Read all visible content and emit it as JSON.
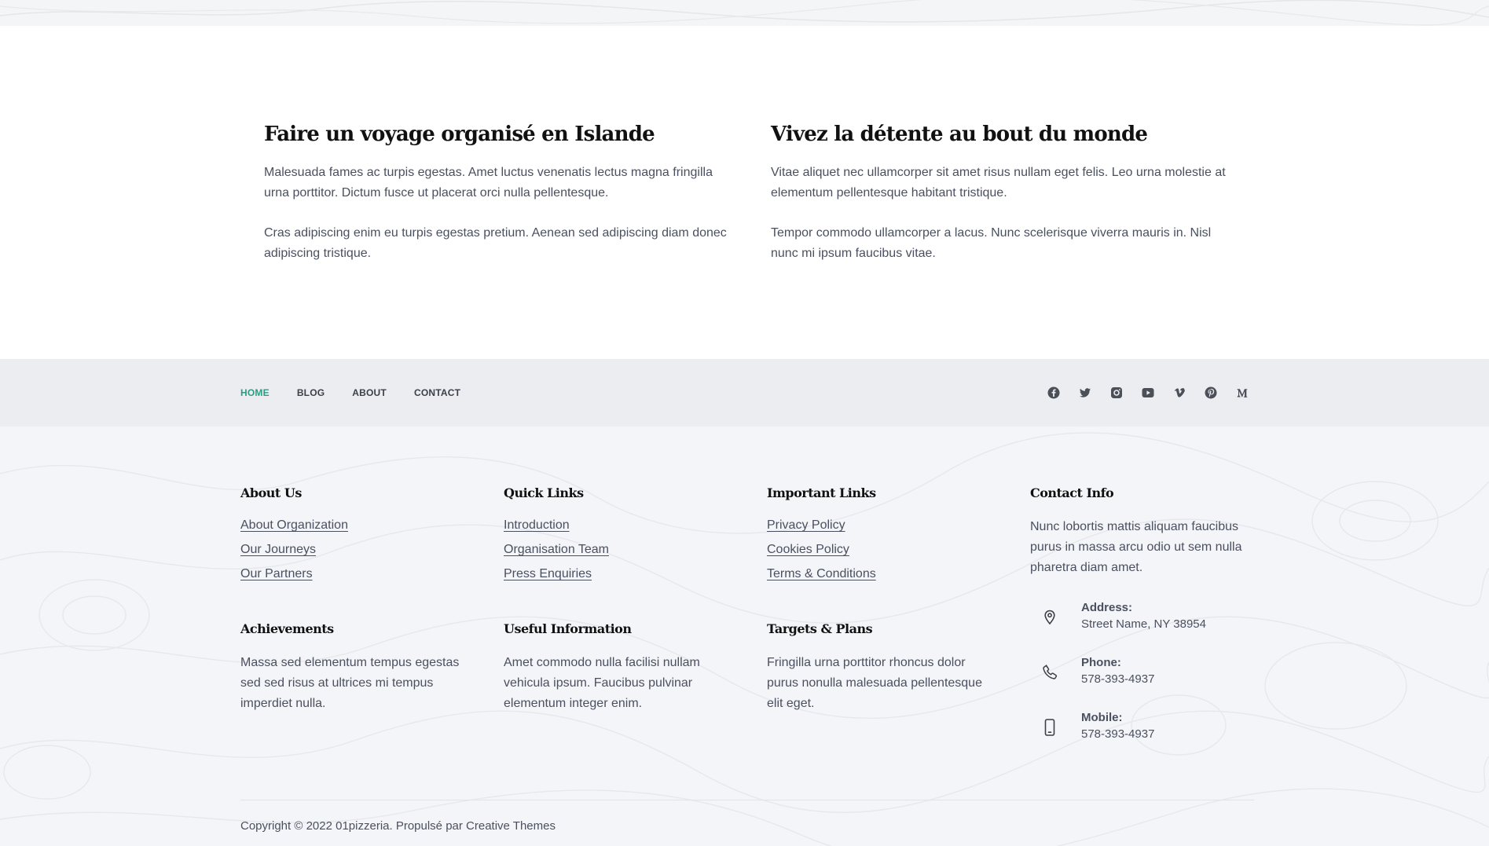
{
  "content": {
    "left": {
      "title": "Faire un voyage organisé en Islande",
      "p1": "Malesuada fames ac turpis egestas. Amet luctus venenatis lectus magna fringilla urna porttitor. Dictum fusce ut placerat orci nulla pellentesque.",
      "p2": "Cras adipiscing enim eu turpis egestas pretium. Aenean sed adipiscing diam donec adipiscing tristique."
    },
    "right": {
      "title": "Vivez la détente au bout du monde",
      "p1": "Vitae aliquet nec ullamcorper sit amet risus nullam eget felis. Leo urna molestie at elementum  pellentesque habitant tristique.",
      "p2": "Tempor commodo ullamcorper a lacus. Nunc scelerisque viverra mauris in. Nisl nunc mi ipsum faucibus vitae."
    }
  },
  "nav": {
    "items": [
      "HOME",
      "BLOG",
      "ABOUT",
      "CONTACT"
    ],
    "active": "HOME",
    "active_color": "#2b9b82"
  },
  "socials": [
    "facebook-icon",
    "twitter-icon",
    "instagram-icon",
    "youtube-icon",
    "vimeo-icon",
    "pinterest-icon",
    "medium-icon"
  ],
  "footer": {
    "about": {
      "title": "About Us",
      "links": [
        "About Organization",
        "Our Journeys",
        "Our Partners"
      ]
    },
    "quick": {
      "title": "Quick Links",
      "links": [
        "Introduction",
        "Organisation Team",
        "Press Enquiries"
      ]
    },
    "important": {
      "title": "Important Links",
      "links": [
        "Privacy Policy",
        "Cookies Policy",
        "Terms & Conditions"
      ]
    },
    "achievements": {
      "title": "Achievements",
      "text": "Massa sed elementum tempus egestas sed sed risus at ultrices mi tempus imperdiet nulla."
    },
    "useful": {
      "title": "Useful Information",
      "text": "Amet commodo nulla facilisi nullam vehicula ipsum. Faucibus pulvinar elementum integer enim."
    },
    "targets": {
      "title": "Targets & Plans",
      "text": "Fringilla urna porttitor rhoncus dolor purus nonulla malesuada pellentesque elit eget."
    },
    "contact": {
      "title": "Contact Info",
      "text": "Nunc lobortis mattis aliquam faucibus purus in massa arcu odio ut sem nulla pharetra diam amet.",
      "address_label": "Address:",
      "address_value": "Street Name, NY 38954",
      "phone_label": "Phone:",
      "phone_value": "578-393-4937",
      "mobile_label": "Mobile:",
      "mobile_value": "578-393-4937"
    },
    "copyright": "Copyright © 2022 01pizzeria. Propulsé par Creative Themes"
  }
}
